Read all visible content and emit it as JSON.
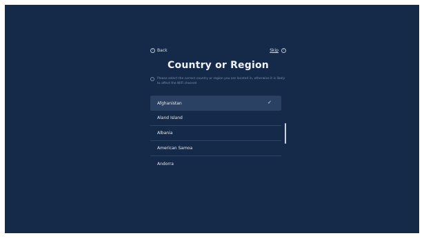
{
  "header": {
    "back_label": "Back",
    "skip_label": "Skip",
    "back_icon": "chevron-left-icon",
    "skip_icon": "chevron-right-icon"
  },
  "title": "Country or Region",
  "note": {
    "icon": "info-icon",
    "text": "Please select the correct country or region you are located in, otherwise it is likely to affect the WiFi channel"
  },
  "countries": [
    {
      "label": "Afghanistan",
      "selected": true
    },
    {
      "label": "Aland Island",
      "selected": false
    },
    {
      "label": "Albania",
      "selected": false
    },
    {
      "label": "American Samoa",
      "selected": false
    },
    {
      "label": "Andorra",
      "selected": false
    }
  ],
  "selected_check": "✓",
  "colors": {
    "background": "#142a48",
    "selected_row": "#2a4163",
    "text": "#e7edf5",
    "muted_text": "#7d90aa"
  }
}
